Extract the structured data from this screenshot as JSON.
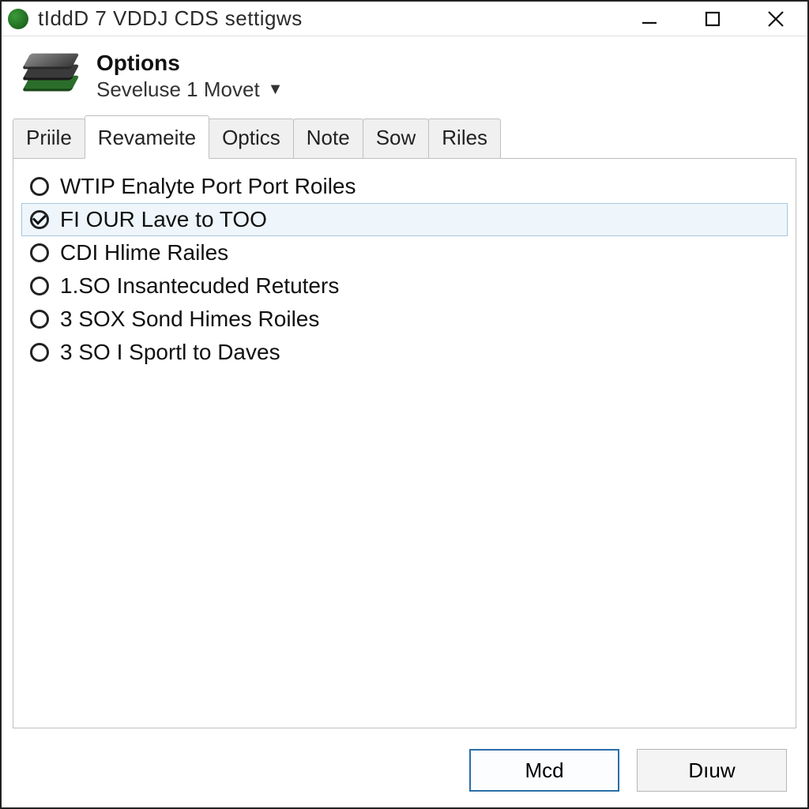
{
  "window": {
    "title": "tIddD 7 VDDJ CDS settigws"
  },
  "header": {
    "title": "Options",
    "subtitle": "Seveluse 1 Movet"
  },
  "tabs": [
    {
      "label": "Priile",
      "active": false
    },
    {
      "label": "Revameite",
      "active": true
    },
    {
      "label": "Optics",
      "active": false
    },
    {
      "label": "Note",
      "active": false
    },
    {
      "label": "Sow",
      "active": false
    },
    {
      "label": "Riles",
      "active": false
    }
  ],
  "options": [
    {
      "label": "WTIP Enalyte Port Port Roiles",
      "checked": false,
      "selected": false
    },
    {
      "label": "FI OUR Lave to TOO",
      "checked": true,
      "selected": true
    },
    {
      "label": "CDI Hlime Railes",
      "checked": false,
      "selected": false
    },
    {
      "label": "1.SO Insantecuded Retuters",
      "checked": false,
      "selected": false
    },
    {
      "label": "3 SOX Sond Himes Roiles",
      "checked": false,
      "selected": false
    },
    {
      "label": "3 SO I Sportl to Daves",
      "checked": false,
      "selected": false
    }
  ],
  "buttons": {
    "primary": "Mcd",
    "secondary": "Dıuw"
  }
}
